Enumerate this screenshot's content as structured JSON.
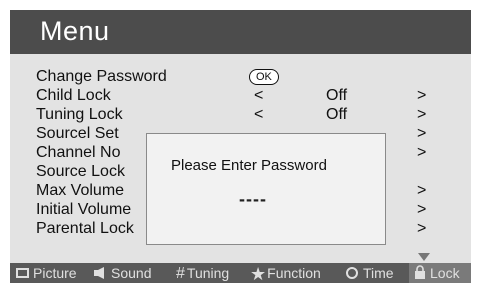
{
  "menu": {
    "title": "Menu",
    "rows": [
      {
        "label": "Change Password",
        "button": "OK"
      },
      {
        "label": "Child Lock",
        "left": "<",
        "value": "Off",
        "right": ">"
      },
      {
        "label": "Tuning Lock",
        "left": "<",
        "value": "Off",
        "right": ">"
      },
      {
        "label": "Sourcel Set",
        "right": ">"
      },
      {
        "label": "Channel No",
        "right": ">"
      },
      {
        "label": "Source Lock"
      },
      {
        "label": "Max Volume",
        "right": ">"
      },
      {
        "label": "Initial Volume",
        "right": ">"
      },
      {
        "label": "Parental Lock",
        "right": ">"
      }
    ]
  },
  "dialog": {
    "prompt": "Please Enter Password",
    "password": "----"
  },
  "tabs": [
    {
      "label": "Picture",
      "icon": "picture-icon"
    },
    {
      "label": "Sound",
      "icon": "speaker-icon"
    },
    {
      "label": "Tuning",
      "icon": "grid-icon"
    },
    {
      "label": "Function",
      "icon": "star-icon"
    },
    {
      "label": "Time",
      "icon": "clock-icon"
    },
    {
      "label": "Lock",
      "icon": "lock-icon",
      "active": true
    }
  ],
  "colors": {
    "titlebar": "#4c4c4c",
    "panel": "#e3e3e3",
    "bottombar": "#595959",
    "active_tab": "#7a7a7a"
  }
}
